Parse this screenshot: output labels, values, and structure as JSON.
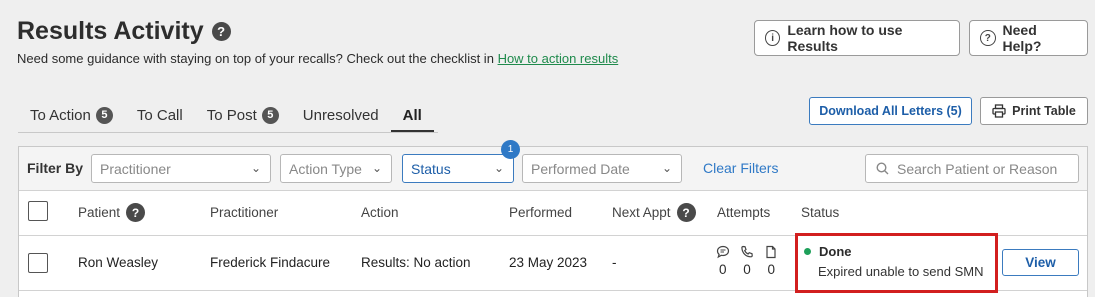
{
  "header": {
    "title": "Results Activity",
    "help_glyph": "?",
    "subtitle": "Need some guidance with staying on top of your recalls? Check out the checklist in",
    "subtitle_link": "How to action results"
  },
  "top_buttons": {
    "learn": {
      "label": "Learn how to use Results",
      "icon": "info-icon"
    },
    "help": {
      "label": "Need Help?",
      "icon": "question-icon"
    }
  },
  "tabs": [
    {
      "label": "To Action",
      "badge": "5"
    },
    {
      "label": "To Call",
      "badge": ""
    },
    {
      "label": "To Post",
      "badge": "5"
    },
    {
      "label": "Unresolved",
      "badge": ""
    },
    {
      "label": "All",
      "badge": "",
      "active": true
    }
  ],
  "actions": {
    "download_label": "Download All Letters (5)",
    "print_label": "Print Table",
    "print_icon": "printer-icon"
  },
  "filters": {
    "label": "Filter By",
    "practitioner_placeholder": "Practitioner",
    "action_type_placeholder": "Action Type",
    "status_placeholder": "Status",
    "status_badge": "1",
    "performed_date_placeholder": "Performed Date",
    "clear_label": "Clear Filters",
    "search_placeholder": "Search Patient or Reason"
  },
  "columns": {
    "patient": "Patient",
    "practitioner": "Practitioner",
    "action": "Action",
    "performed": "Performed",
    "next_appt": "Next Appt",
    "attempts": "Attempts",
    "status": "Status"
  },
  "rows": [
    {
      "patient": "Ron Weasley",
      "practitioner": "Frederick Findacure",
      "action": "Results: No action",
      "performed": "23 May 2023",
      "next_appt": "-",
      "attempts": {
        "sms": "0",
        "call": "0",
        "letter": "0"
      },
      "status": "Done",
      "status_detail": "Expired unable to send SMN",
      "status_color": "#1ea05a",
      "view_label": "View"
    }
  ],
  "colors": {
    "accent_blue": "#1d5ea8",
    "highlight_red": "#d21f1f",
    "link_green": "#1f8a4c"
  }
}
